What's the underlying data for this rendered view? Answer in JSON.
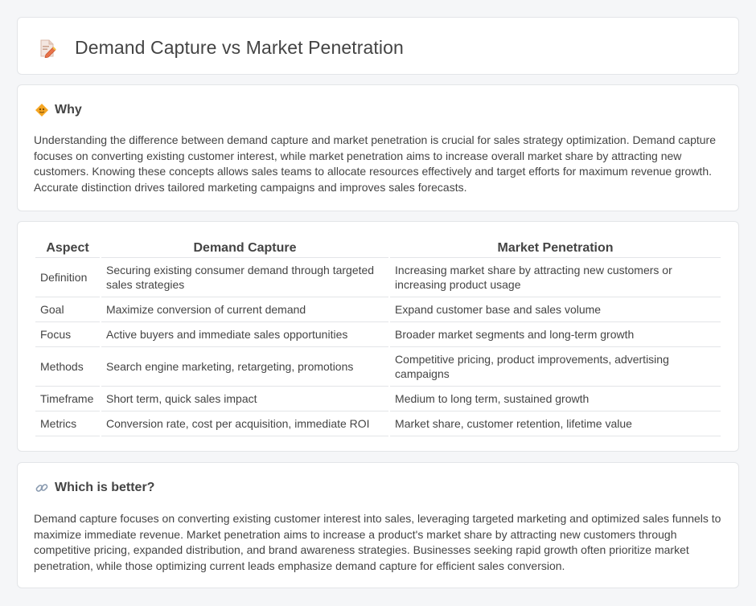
{
  "title": "Demand Capture vs Market Penetration",
  "why": {
    "heading": "Why",
    "text": "Understanding the difference between demand capture and market penetration is crucial for sales strategy optimization. Demand capture focuses on converting existing customer interest, while market penetration aims to increase overall market share by attracting new customers. Knowing these concepts allows sales teams to allocate resources effectively and target efforts for maximum revenue growth. Accurate distinction drives tailored marketing campaigns and improves sales forecasts."
  },
  "table": {
    "headers": [
      "Aspect",
      "Demand Capture",
      "Market Penetration"
    ],
    "rows": [
      [
        "Definition",
        "Securing existing consumer demand through targeted sales strategies",
        "Increasing market share by attracting new customers or increasing product usage"
      ],
      [
        "Goal",
        "Maximize conversion of current demand",
        "Expand customer base and sales volume"
      ],
      [
        "Focus",
        "Active buyers and immediate sales opportunities",
        "Broader market segments and long-term growth"
      ],
      [
        "Methods",
        "Search engine marketing, retargeting, promotions",
        "Competitive pricing, product improvements, advertising campaigns"
      ],
      [
        "Timeframe",
        "Short term, quick sales impact",
        "Medium to long term, sustained growth"
      ],
      [
        "Metrics",
        "Conversion rate, cost per acquisition, immediate ROI",
        "Market share, customer retention, lifetime value"
      ]
    ]
  },
  "better": {
    "heading": "Which is better?",
    "text": "Demand capture focuses on converting existing customer interest into sales, leveraging targeted marketing and optimized sales funnels to maximize immediate revenue. Market penetration aims to increase a product's market share by attracting new customers through competitive pricing, expanded distribution, and brand awareness strategies. Businesses seeking rapid growth often prioritize market penetration, while those optimizing current leads emphasize demand capture for efficient sales conversion."
  },
  "icons": {
    "title": "document-pencil-icon",
    "why": "diamond-icon",
    "better": "link-icon"
  }
}
